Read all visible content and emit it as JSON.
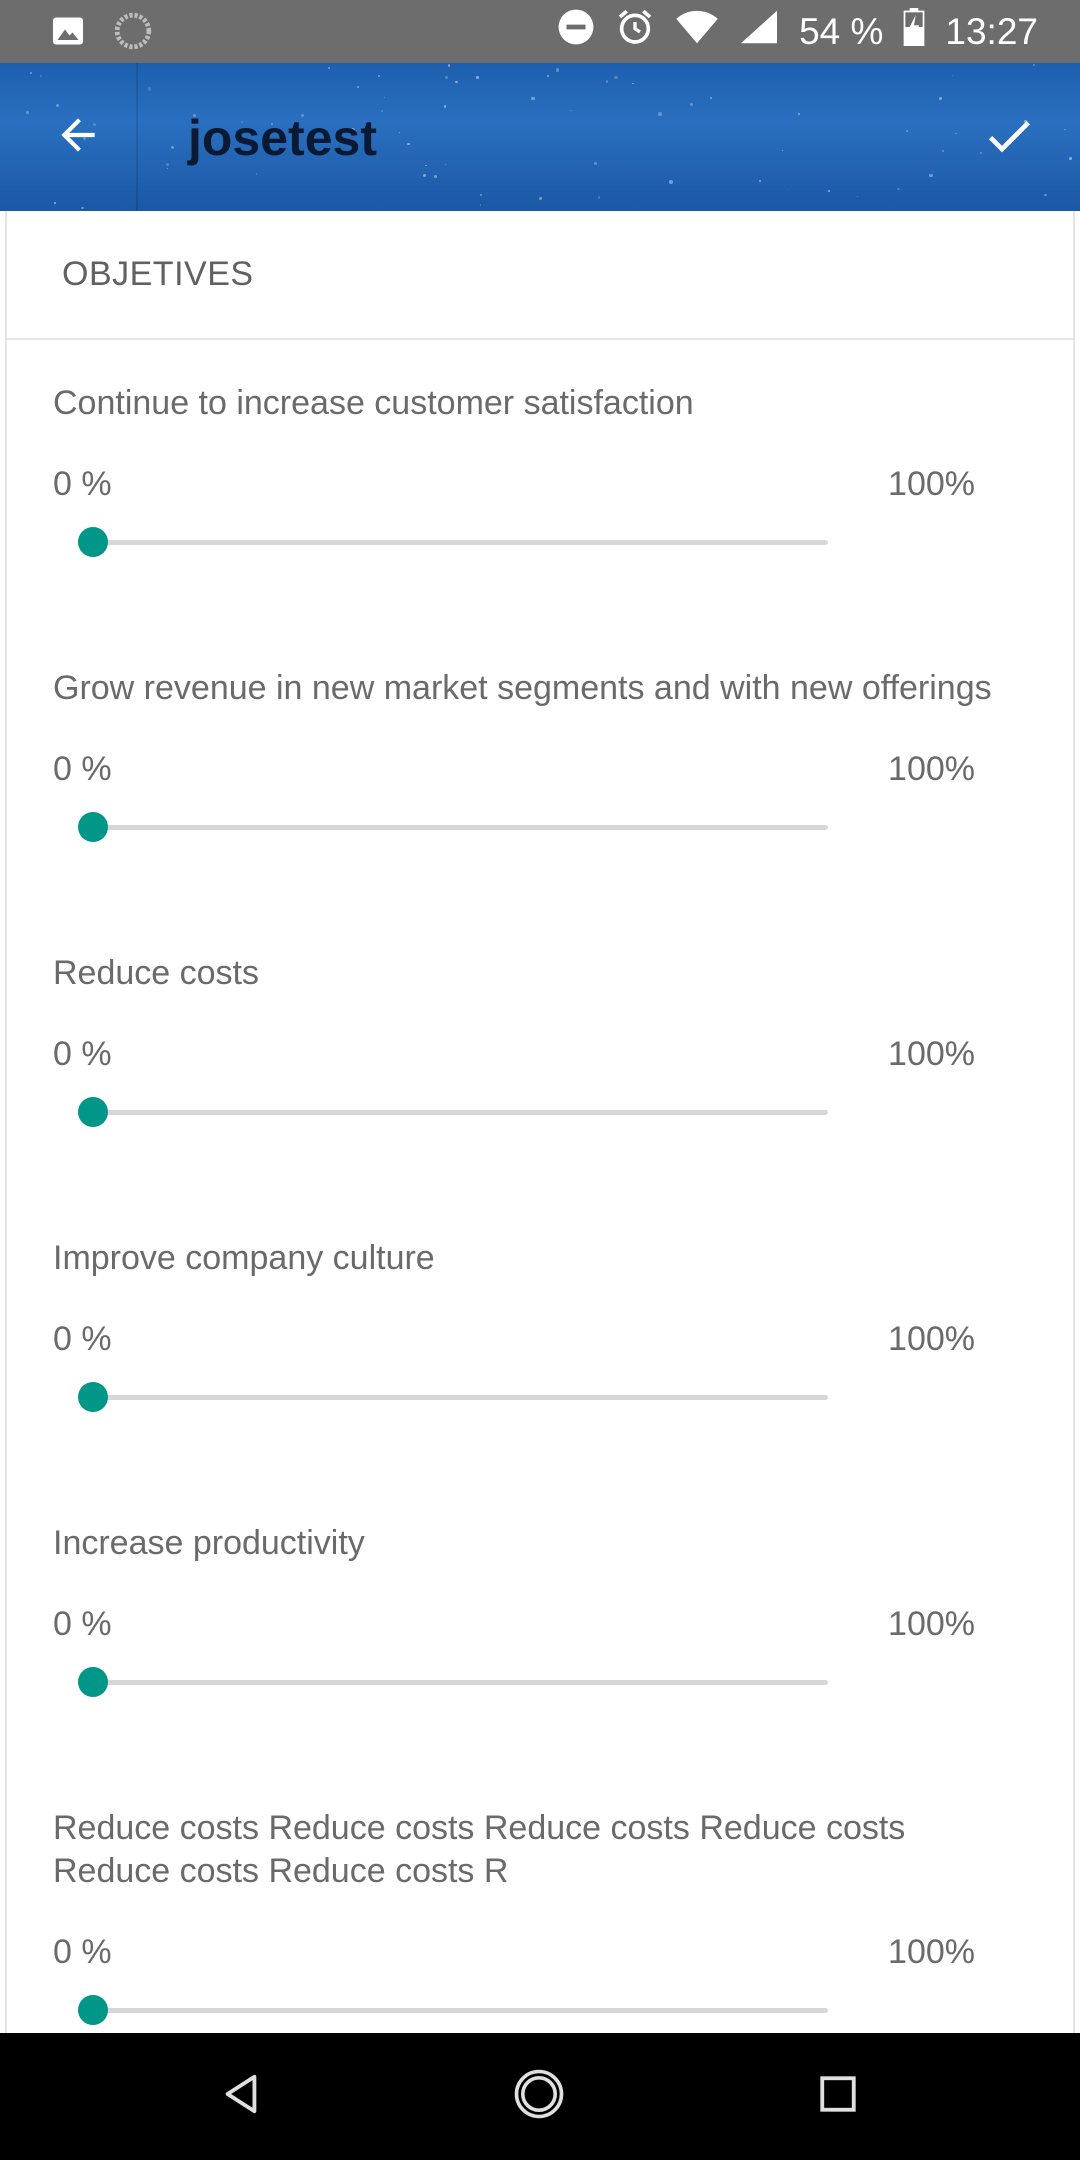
{
  "status_bar": {
    "battery": "54 %",
    "time": "13:27",
    "icons": [
      "image-icon",
      "circle-progress-icon",
      "do-not-disturb-icon",
      "alarm-icon",
      "wifi-icon",
      "signal-icon",
      "battery-charging-icon"
    ]
  },
  "app_bar": {
    "title": "josetest",
    "back_icon": "arrow-back-icon",
    "confirm_icon": "check-icon",
    "background_color": "#1d5fae"
  },
  "section": {
    "header": "OBJETIVES"
  },
  "accent_color": "#009688",
  "objectives": [
    {
      "label": "Continue to increase customer satisfaction",
      "min_label": "0 %",
      "max_label": "100%",
      "value_percent": 0
    },
    {
      "label": "Grow revenue in new market segments and with new offerings",
      "min_label": "0 %",
      "max_label": "100%",
      "value_percent": 0
    },
    {
      "label": "Reduce costs",
      "min_label": "0 %",
      "max_label": "100%",
      "value_percent": 0
    },
    {
      "label": "Improve company culture",
      "min_label": "0 %",
      "max_label": "100%",
      "value_percent": 0
    },
    {
      "label": "Increase productivity",
      "min_label": "0 %",
      "max_label": "100%",
      "value_percent": 0
    },
    {
      "label": "Reduce costs Reduce costs Reduce costs Reduce costs Reduce costs Reduce costs R",
      "min_label": "0 %",
      "max_label": "100%",
      "value_percent": 0
    }
  ],
  "nav_bar": {
    "icons": [
      "nav-back-icon",
      "nav-home-icon",
      "nav-recents-icon"
    ]
  }
}
